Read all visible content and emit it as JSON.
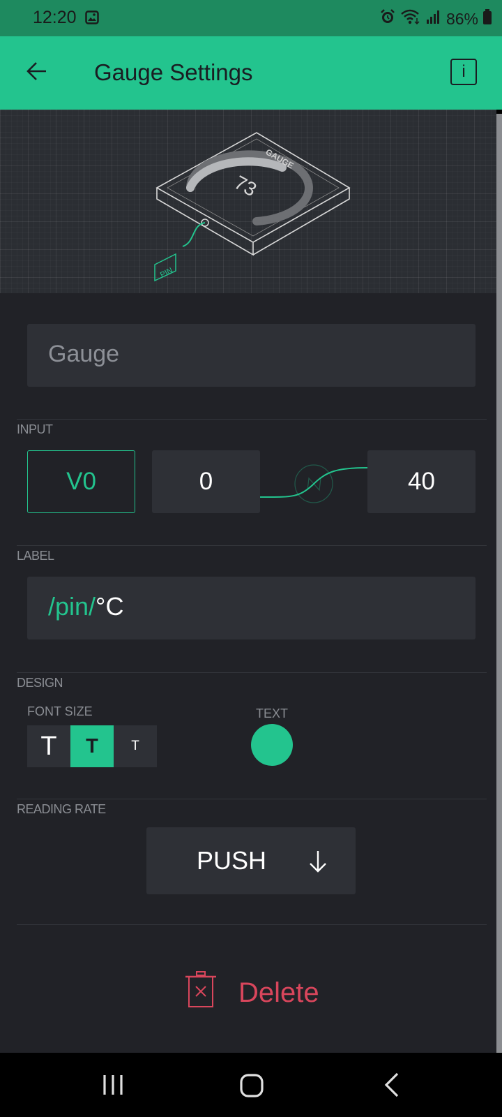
{
  "status_bar": {
    "time": "12:20",
    "battery": "86%",
    "icons": [
      "image-icon",
      "alarm-icon",
      "wifi-icon",
      "signal-icon",
      "battery-icon"
    ]
  },
  "app_bar": {
    "title": "Gauge Settings",
    "info_label": "i"
  },
  "preview": {
    "widget_name": "GAUGE",
    "value": "73",
    "pin_tag": "PIN"
  },
  "name_field": {
    "value": "Gauge"
  },
  "input": {
    "section": "INPUT",
    "pin": "V0",
    "min": "0",
    "max": "40"
  },
  "label": {
    "section": "LABEL",
    "pin_token": "/pin/",
    "unit": "°C"
  },
  "design": {
    "section": "DESIGN",
    "font_size_title": "FONT SIZE",
    "font_sizes": [
      "T",
      "T",
      "T"
    ],
    "selected_font_index": 1,
    "text_title": "TEXT",
    "text_color": "#23c48e"
  },
  "reading_rate": {
    "section": "READING RATE",
    "value": "PUSH"
  },
  "delete_label": "Delete",
  "colors": {
    "accent": "#23c48e",
    "danger": "#d9465c",
    "background": "#212227",
    "field": "#2e3036"
  }
}
